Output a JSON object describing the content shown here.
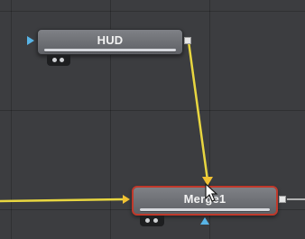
{
  "nodes": {
    "hud": {
      "title": "HUD"
    },
    "merge": {
      "title": "Merge1"
    }
  },
  "colors": {
    "canvas": "#3c3d40",
    "wire": "#e8d640",
    "input_arrow": "#58b4e6",
    "background_input_arrow": "#f1c232",
    "selection": "#c0392b"
  },
  "icons": {
    "cursor": "arrow-pointer-icon",
    "output": "output-port-icon",
    "input": "input-triangle-icon"
  }
}
